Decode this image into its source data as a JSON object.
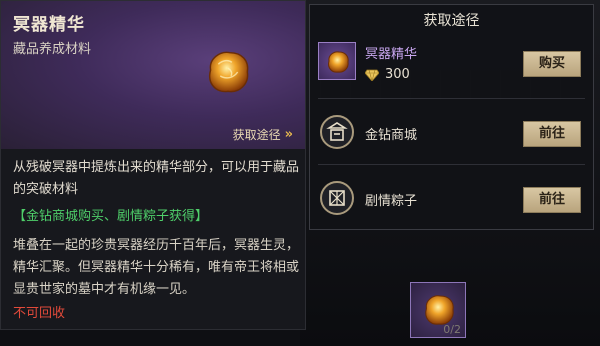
{
  "item": {
    "name": "冥器精华",
    "type": "藏品养成材料",
    "obtain_link": "获取途径",
    "description": "从残破冥器中提炼出来的精华部分，可以用于藏品的突破材料",
    "source": "【金钻商城购买、剧情粽子获得】",
    "lore": "堆叠在一起的珍贵冥器经历千百年后，冥器生灵，精华汇聚。但冥器精华十分稀有，唯有帝王将相或显贵世家的墓中才有机缘一见。",
    "no_return": "不可回收"
  },
  "obtain_panel": {
    "title": "获取途径",
    "rows": [
      {
        "name": "冥器精华",
        "price": "300",
        "button": "购买",
        "icon": "amber-nugget-icon"
      },
      {
        "name": "金钻商城",
        "button": "前往",
        "icon": "shop-icon"
      },
      {
        "name": "剧情粽子",
        "button": "前往",
        "icon": "zongzi-icon"
      }
    ]
  },
  "slot": {
    "count": "0/2"
  },
  "colors": {
    "accent_gold": "#e3b64f",
    "source_green": "#4fcf6a",
    "warning_red": "#e24a3a",
    "rare_purple": "#c8a6ef"
  }
}
